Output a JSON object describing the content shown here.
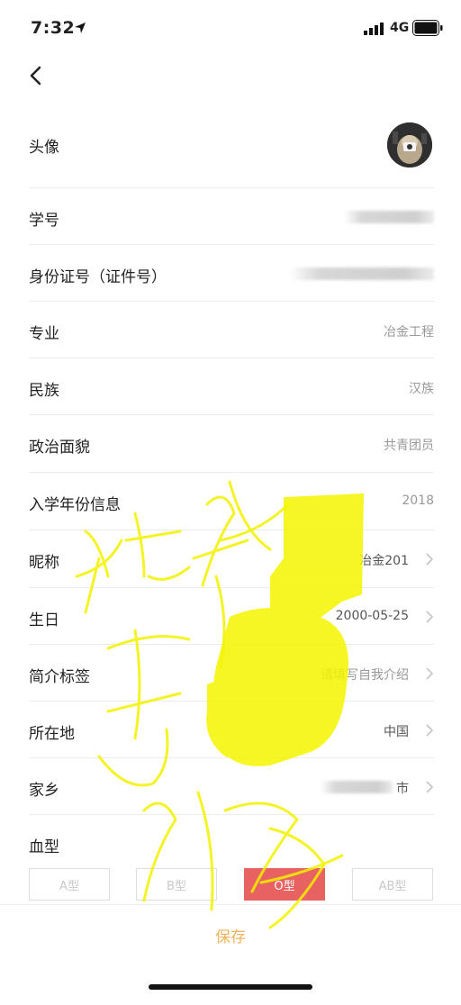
{
  "status": {
    "time": "7:32",
    "network": "4G"
  },
  "profile": {
    "avatar_label": "头像",
    "student_id_label": "学号",
    "id_number_label": "身份证号（证件号）",
    "major_label": "专业",
    "major_value": "冶金工程",
    "ethnicity_label": "民族",
    "ethnicity_value": "汉族",
    "political_label": "政治面貌",
    "political_value": "共青团员",
    "enroll_label": "入学年份信息",
    "enroll_value": "2018",
    "nickname_label": "昵称",
    "nickname_value": "冶金201",
    "birthday_label": "生日",
    "birthday_value": "2000-05-25",
    "bio_label": "简介标签",
    "bio_value": "请填写自我介绍",
    "location_label": "所在地",
    "location_value": "中国",
    "hometown_label": "家乡",
    "hometown_value": "市",
    "blood_label": "血型"
  },
  "blood_types": [
    "A型",
    "B型",
    "O型",
    "AB型"
  ],
  "selected_blood_type": "O型",
  "save_label": "保存",
  "colors": {
    "accent": "#f0b35a",
    "selected": "#e86262",
    "highlighter": "#f5f500"
  }
}
